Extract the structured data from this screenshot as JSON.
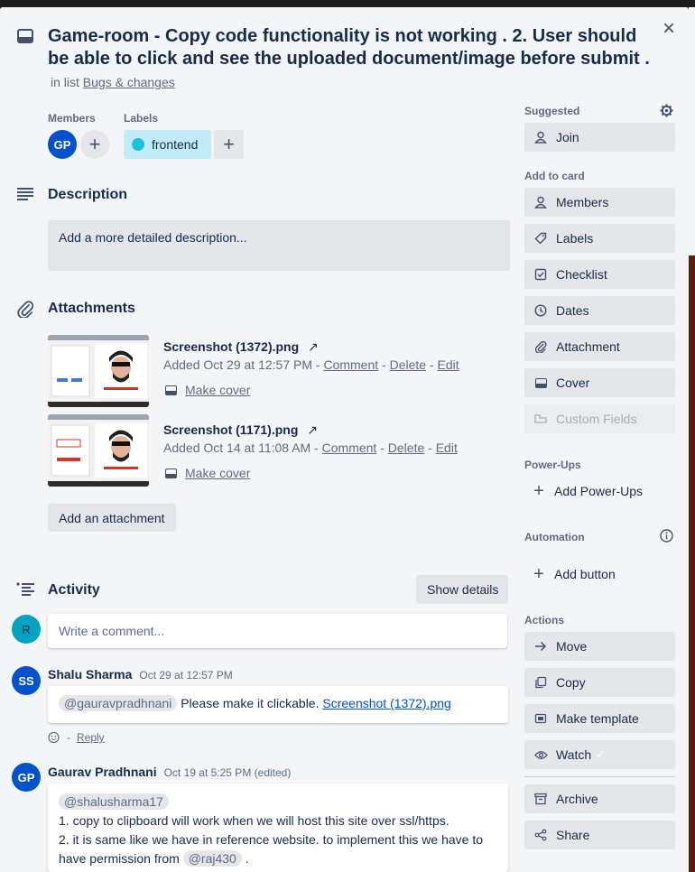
{
  "card": {
    "title": "Game-room - Copy code functionality is not working . 2. User should be able to click and see the uploaded document/image before submit .",
    "in_list_prefix": "in list",
    "list_name": "Bugs & changes"
  },
  "members": {
    "label": "Members",
    "avatar": "GP",
    "avatar_color": "#0052cc"
  },
  "labels": {
    "label": "Labels",
    "items": [
      {
        "name": "frontend",
        "color": "#1fbfe0"
      }
    ]
  },
  "description": {
    "heading": "Description",
    "placeholder": "Add a more detailed description..."
  },
  "attachments": {
    "heading": "Attachments",
    "items": [
      {
        "name": "Screenshot (1372).png",
        "added": "Added Oct 29 at 12:57 PM",
        "comment": "Comment",
        "delete": "Delete",
        "edit": "Edit",
        "make_cover": "Make cover"
      },
      {
        "name": "Screenshot (1171).png",
        "added": "Added Oct 14 at 11:08 AM",
        "comment": "Comment",
        "delete": "Delete",
        "edit": "Edit",
        "make_cover": "Make cover"
      }
    ],
    "add_button": "Add an attachment"
  },
  "activity": {
    "heading": "Activity",
    "show_details": "Show details",
    "current_user_avatar": "R",
    "comment_placeholder": "Write a comment...",
    "comments": [
      {
        "avatar": "SS",
        "author": "Shalu Sharma",
        "time": "Oct 29 at 12:57 PM",
        "mention": "@gauravpradhnani",
        "text": "Please make it clickable.",
        "link": "Screenshot (1372).png",
        "reply": "Reply"
      },
      {
        "avatar": "GP",
        "author": "Gaurav Pradhnani",
        "time": "Oct 19 at 5:25 PM (edited)",
        "mention": "@shalusharma17",
        "line1": "1. copy to clipboard will work when we will host this site over ssl/https.",
        "line2": "2. it is same like we have in reference website. to implement this we have to",
        "line3_prefix": "have permission from",
        "line3_mention": "@raj430",
        "line3_suffix": "."
      }
    ]
  },
  "sidebar": {
    "suggested_label": "Suggested",
    "join": "Join",
    "add_to_card_label": "Add to card",
    "add_to_card": [
      "Members",
      "Labels",
      "Checklist",
      "Dates",
      "Attachment",
      "Cover",
      "Custom Fields"
    ],
    "powerups_label": "Power-Ups",
    "add_powerups": "Add Power-Ups",
    "automation_label": "Automation",
    "add_button": "Add button",
    "actions_label": "Actions",
    "actions": [
      "Move",
      "Copy",
      "Make template",
      "Watch"
    ],
    "archive": "Archive",
    "share": "Share"
  },
  "colors": {
    "accent_blue": "#0052cc",
    "teal": "#00a3bf",
    "label_bg": "#c1ecf5"
  }
}
